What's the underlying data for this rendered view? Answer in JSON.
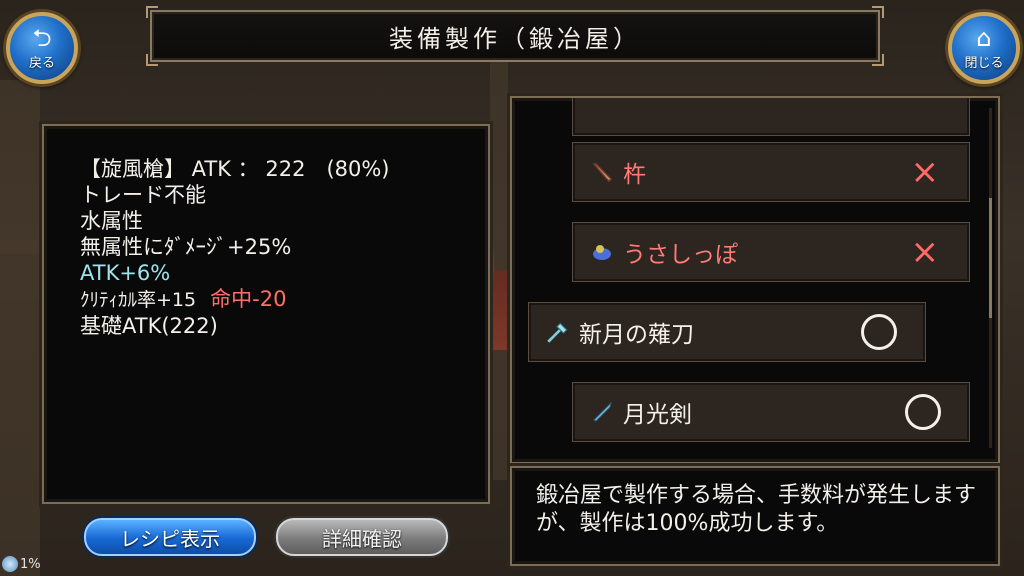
{
  "header": {
    "title": "装備製作（鍛冶屋）",
    "back_label": "戻る",
    "close_label": "閉じる",
    "back_icon": "return-arrow-icon",
    "close_icon": "home-icon"
  },
  "item_details": {
    "line1": "【旋風槍】 ATK ： 222　(80%)",
    "line2": "トレード不能",
    "line3": "水属性",
    "line4": "無属性にﾀﾞﾒｰｼﾞ+25%",
    "line5": "ATK+6%",
    "line6_a": "ｸﾘﾃｨｶﾙ率+15",
    "line6_b": "命中-20",
    "line7": "基礎ATK(222)"
  },
  "recipes": [
    {
      "name": "杵",
      "status": "×",
      "icon": "pestle-icon"
    },
    {
      "name": "うさしっぽ",
      "status": "×",
      "icon": "rabbit-tail-icon"
    },
    {
      "name": "新月の薙刀",
      "status": "○",
      "icon": "halberd-icon"
    },
    {
      "name": "月光剣",
      "status": "○",
      "icon": "sword-icon"
    }
  ],
  "message": "鍛冶屋で製作する場合、手数料が発生しますが、製作は100%成功します。",
  "buttons": {
    "recipe_display": "レシピ表示",
    "detail_check": "詳細確認"
  },
  "progress": {
    "value": "1%"
  },
  "colors": {
    "unavailable": "#ff6f6a",
    "available": "#f4f1ec",
    "accent_blue": "#1768d4"
  }
}
